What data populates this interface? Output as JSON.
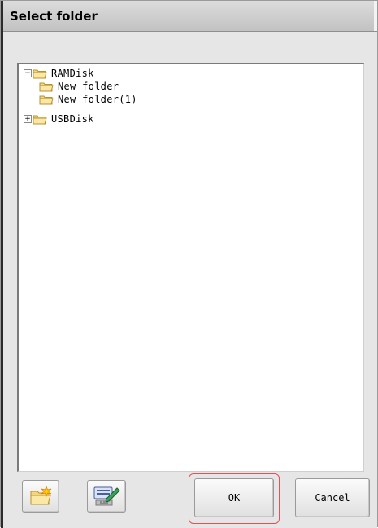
{
  "window": {
    "title": "Select folder"
  },
  "tree": {
    "nodes": [
      {
        "label": "RAMDisk",
        "expander": "−"
      },
      {
        "label": "New folder"
      },
      {
        "label": "New folder(1)"
      },
      {
        "label": "USBDisk",
        "expander": "+"
      }
    ]
  },
  "toolbar": {
    "new_folder_icon": "new-folder-icon",
    "rename_icon": "keyboard-edit-icon",
    "ok_label": "OK",
    "cancel_label": "Cancel"
  },
  "colors": {
    "folder": "#f3d77a",
    "highlight": "#e0525a"
  }
}
